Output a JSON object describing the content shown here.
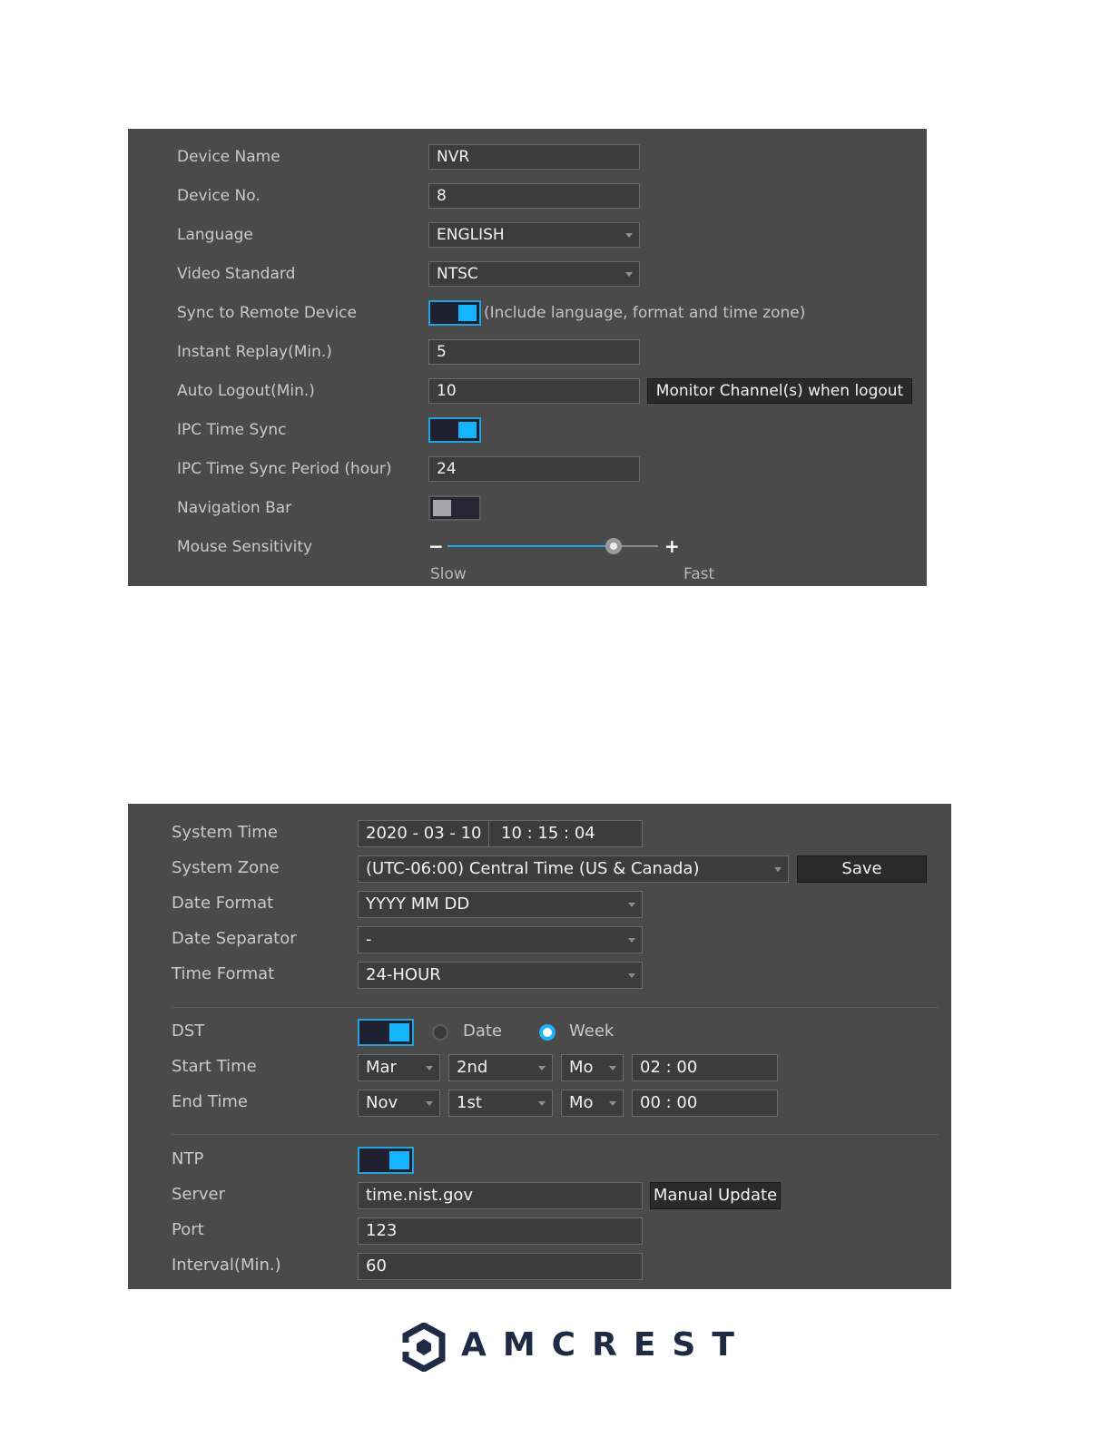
{
  "general": {
    "device_name": {
      "label": "Device Name",
      "value": "NVR"
    },
    "device_no": {
      "label": "Device No.",
      "value": "8"
    },
    "language": {
      "label": "Language",
      "value": "ENGLISH"
    },
    "video_standard": {
      "label": "Video Standard",
      "value": "NTSC"
    },
    "sync_remote": {
      "label": "Sync to Remote Device",
      "enabled": true,
      "note": "(Include language, format and time zone)"
    },
    "instant_replay": {
      "label": "Instant Replay(Min.)",
      "value": "5"
    },
    "auto_logout": {
      "label": "Auto Logout(Min.)",
      "value": "10",
      "button": "Monitor Channel(s) when logout"
    },
    "ipc_time_sync": {
      "label": "IPC Time Sync",
      "enabled": true
    },
    "ipc_sync_period": {
      "label": "IPC Time Sync Period (hour)",
      "value": "24"
    },
    "navigation_bar": {
      "label": "Navigation Bar",
      "enabled": false
    },
    "mouse_sensitivity": {
      "label": "Mouse Sensitivity",
      "minus": "−",
      "plus": "+",
      "slow": "Slow",
      "fast": "Fast",
      "level_fraction": 0.79
    }
  },
  "datetime": {
    "system_time": {
      "label": "System Time",
      "date": "2020  - 03 - 10",
      "time": "10 : 15 : 04"
    },
    "system_zone": {
      "label": "System Zone",
      "value": "(UTC-06:00) Central Time (US & Canada)",
      "save": "Save"
    },
    "date_format": {
      "label": "Date Format",
      "value": "YYYY MM DD"
    },
    "date_separator": {
      "label": "Date Separator",
      "value": "-"
    },
    "time_format": {
      "label": "Time Format",
      "value": "24-HOUR"
    },
    "dst": {
      "label": "DST",
      "enabled": true,
      "option_date": "Date",
      "option_week": "Week",
      "selected": "Week"
    },
    "start_time": {
      "label": "Start Time",
      "month": "Mar",
      "week": "2nd",
      "day": "Mo",
      "time": "02 : 00"
    },
    "end_time": {
      "label": "End Time",
      "month": "Nov",
      "week": "1st",
      "day": "Mo",
      "time": "00 : 00"
    },
    "ntp": {
      "label": "NTP",
      "enabled": true
    },
    "server": {
      "label": "Server",
      "value": "time.nist.gov",
      "button": "Manual Update"
    },
    "port": {
      "label": "Port",
      "value": "123"
    },
    "interval": {
      "label": "Interval(Min.)",
      "value": "60"
    }
  },
  "brand": {
    "name": "AMCREST",
    "color": "#1f2a44",
    "accent": "#15b4ff"
  }
}
